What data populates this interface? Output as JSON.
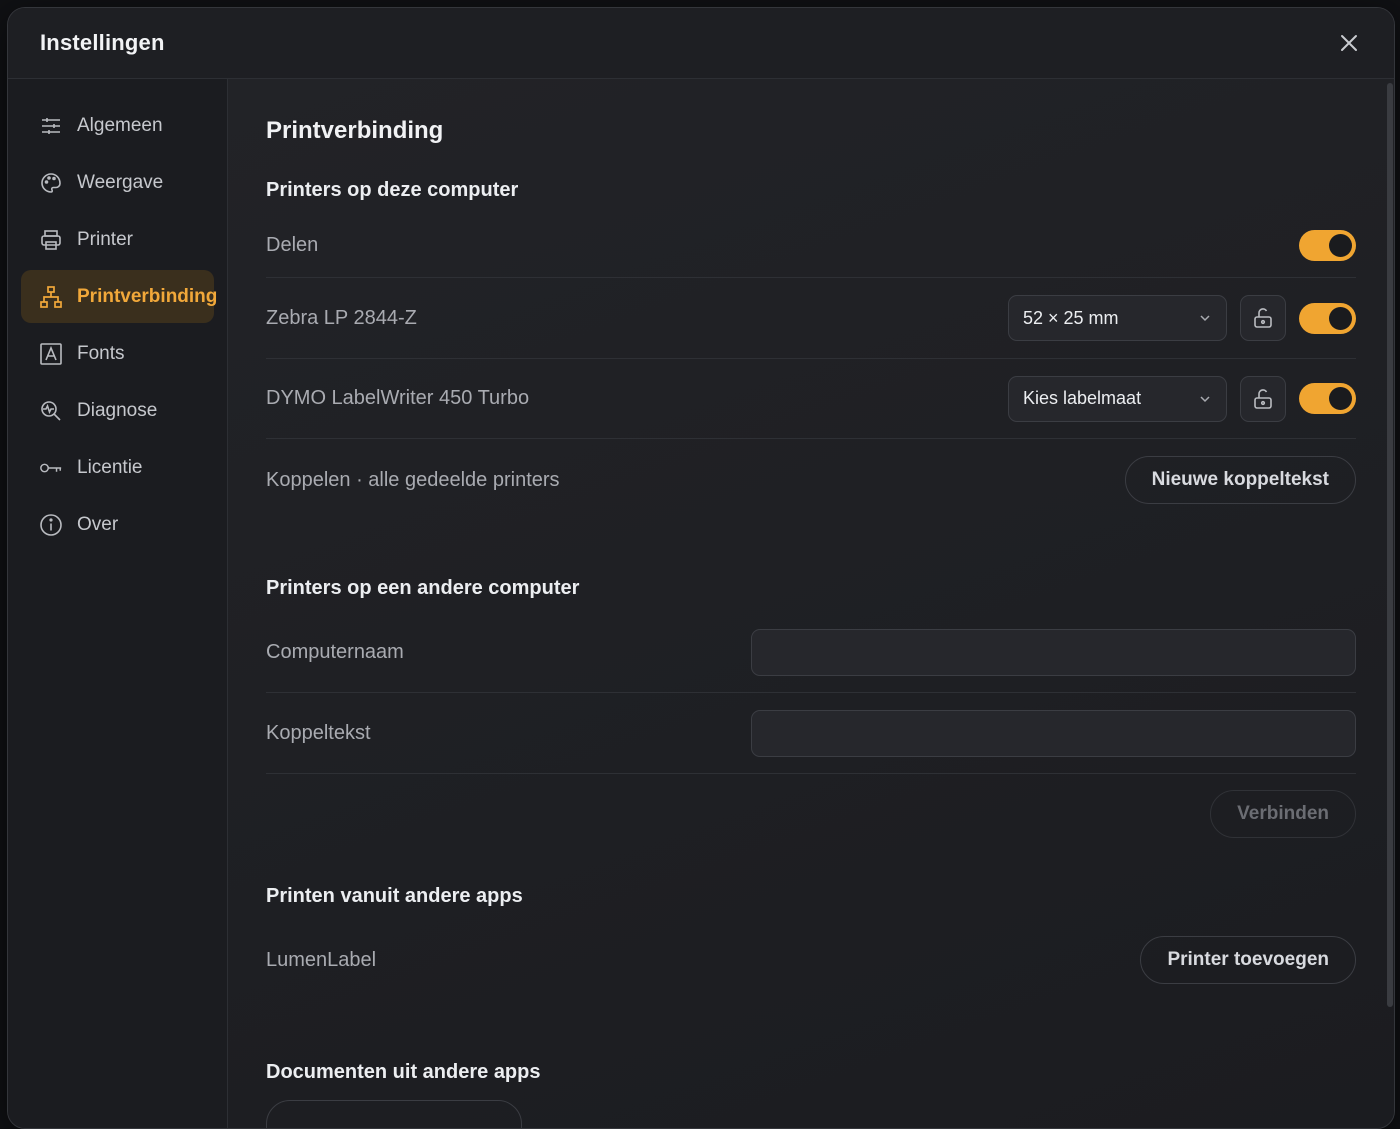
{
  "dialog": {
    "title": "Instellingen"
  },
  "sidebar": {
    "items": [
      {
        "label": "Algemeen",
        "icon": "sliders-icon",
        "active": false
      },
      {
        "label": "Weergave",
        "icon": "palette-icon",
        "active": false
      },
      {
        "label": "Printer",
        "icon": "printer-icon",
        "active": false
      },
      {
        "label": "Printverbinding",
        "icon": "network-icon",
        "active": true
      },
      {
        "label": "Fonts",
        "icon": "font-icon",
        "active": false
      },
      {
        "label": "Diagnose",
        "icon": "diagnose-icon",
        "active": false
      },
      {
        "label": "Licentie",
        "icon": "key-icon",
        "active": false
      },
      {
        "label": "Over",
        "icon": "info-icon",
        "active": false
      }
    ]
  },
  "main": {
    "page_title": "Printverbinding",
    "local": {
      "heading": "Printers op deze computer",
      "share_label": "Delen",
      "share_on": true,
      "printers": [
        {
          "name": "Zebra LP 2844-Z",
          "size": "52 × 25 mm",
          "on": true
        },
        {
          "name": "DYMO LabelWriter 450 Turbo",
          "size": "Kies labelmaat",
          "on": true
        }
      ],
      "pair_label": "Koppelen · alle gedeelde printers",
      "pair_button": "Nieuwe koppeltekst"
    },
    "remote": {
      "heading": "Printers op een andere computer",
      "computer_label": "Computernaam",
      "computer_value": "",
      "code_label": "Koppeltekst",
      "code_value": "",
      "connect_button": "Verbinden"
    },
    "apps": {
      "heading": "Printen vanuit andere apps",
      "app_label": "LumenLabel",
      "add_button": "Printer toevoegen"
    },
    "documents": {
      "heading": "Documenten uit andere apps"
    }
  },
  "colors": {
    "accent": "#f0a531",
    "active_bg": "#3a2f1d",
    "background": "#1c1d21"
  }
}
